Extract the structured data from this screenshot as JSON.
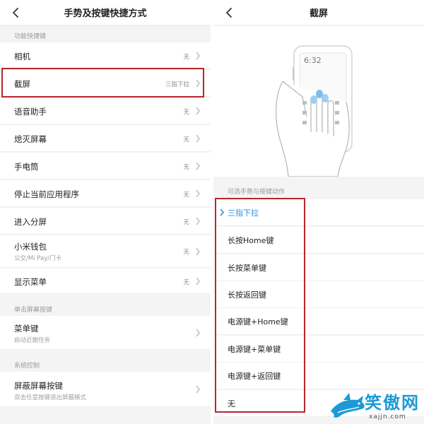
{
  "left": {
    "title": "手势及按键快捷方式",
    "sections": [
      {
        "label": "功能快捷键",
        "items": [
          {
            "title": "相机",
            "value": "无"
          },
          {
            "title": "截屏",
            "value": "三指下拉"
          },
          {
            "title": "语音助手",
            "value": "无"
          },
          {
            "title": "熄灭屏幕",
            "value": "无"
          },
          {
            "title": "手电筒",
            "value": "无"
          },
          {
            "title": "停止当前应用程序",
            "value": "无"
          },
          {
            "title": "进入分屏",
            "value": "无"
          },
          {
            "title": "小米钱包",
            "subtitle": "公交/Mi Pay/门卡",
            "value": "无"
          },
          {
            "title": "显示菜单",
            "value": "无"
          }
        ]
      },
      {
        "label": "单击屏幕按键",
        "items": [
          {
            "title": "菜单键",
            "subtitle": "启动近期任务"
          }
        ]
      },
      {
        "label": "系统控制",
        "items": [
          {
            "title": "屏蔽屏幕按键",
            "subtitle": "双击任意按键退出屏蔽模式"
          }
        ]
      }
    ]
  },
  "right": {
    "title": "截屏",
    "illustration": {
      "time": "6:32"
    },
    "options_label": "可选手势与按键动作",
    "options": [
      "三指下拉",
      "长按Home键",
      "长按菜单键",
      "长按返回键",
      "电源键+Home键",
      "电源键+菜单键",
      "电源键+返回键",
      "无"
    ],
    "selected": "三指下拉"
  },
  "watermark": {
    "text": "笑傲网",
    "url": "xajjn.com"
  },
  "colors": {
    "highlight": "#b8262d",
    "accent": "#2a8fe2",
    "watermark": "#1c9ad6",
    "background": "#f4f4f4"
  },
  "icons": {
    "back": "chevron-left-icon",
    "row": "chevron-right-icon",
    "selected": "check-icon",
    "logo": "shark-logo-icon"
  }
}
